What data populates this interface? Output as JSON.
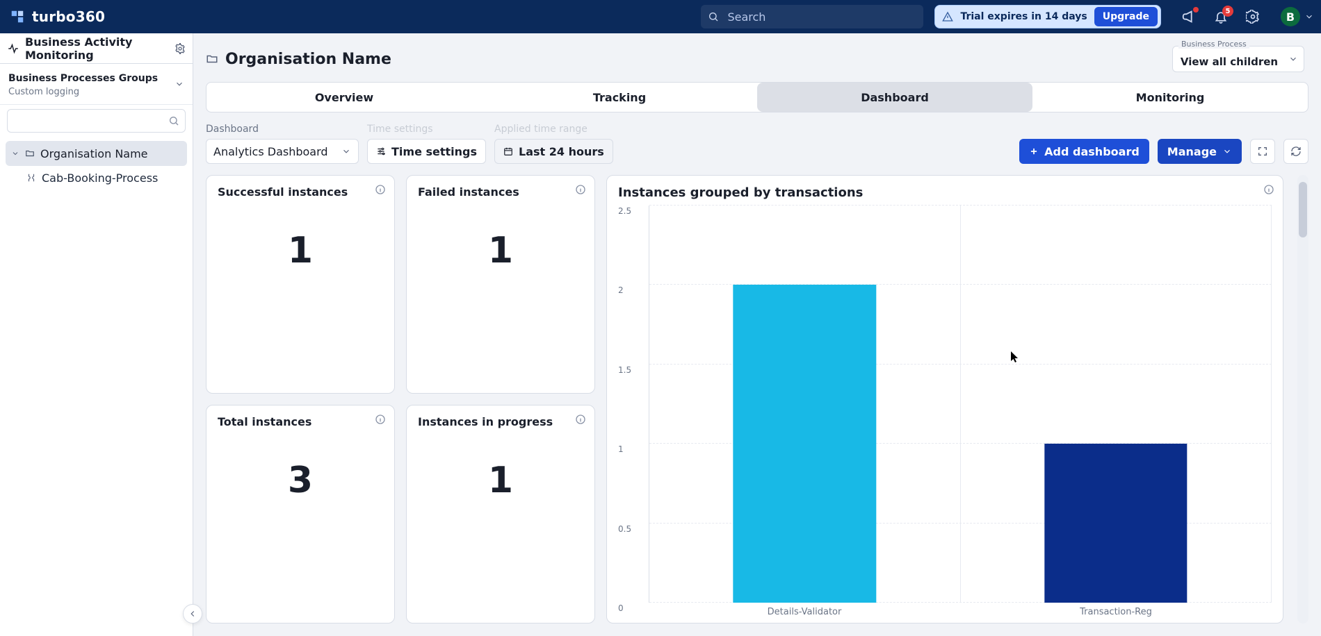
{
  "header": {
    "brand": "turbo360",
    "search_placeholder": "Search",
    "trial_text": "Trial expires in 14 days",
    "upgrade_label": "Upgrade",
    "notif_count": "5",
    "avatar_initial": "B"
  },
  "sidebar": {
    "title": "Business Activity Monitoring",
    "group_title": "Business Processes Groups",
    "group_sub": "Custom logging",
    "org_node": "Organisation Name",
    "child_item": "Cab-Booking-Process"
  },
  "page": {
    "folder_title": "Organisation Name",
    "bp_label": "Business Process",
    "bp_value": "View all children",
    "tabs": [
      "Overview",
      "Tracking",
      "Dashboard",
      "Monitoring"
    ],
    "active_tab_index": 2
  },
  "toolbar": {
    "dashboard_label": "Dashboard",
    "dashboard_value": "Analytics Dashboard",
    "ghost_a": "Time settings",
    "ghost_b": "Applied time range",
    "time_settings_label": "Time settings",
    "last24_label": "Last 24 hours",
    "add_dashboard_label": "Add dashboard",
    "manage_label": "Manage"
  },
  "cards": {
    "success_title": "Successful instances",
    "success_value": "1",
    "failed_title": "Failed instances",
    "failed_value": "1",
    "total_title": "Total instances",
    "total_value": "3",
    "inprog_title": "Instances in progress",
    "inprog_value": "1"
  },
  "chart": {
    "title": "Instances grouped by transactions"
  },
  "chart_data": {
    "type": "bar",
    "categories": [
      "Details-Validator",
      "Transaction-Reg"
    ],
    "values": [
      2,
      1
    ],
    "colors": [
      "#18b9e6",
      "#0b2d8a"
    ],
    "title": "Instances grouped by transactions",
    "xlabel": "",
    "ylabel": "",
    "yticks": [
      0,
      0.5,
      1,
      1.5,
      2,
      2.5
    ],
    "ylim": [
      0,
      2.5
    ]
  }
}
